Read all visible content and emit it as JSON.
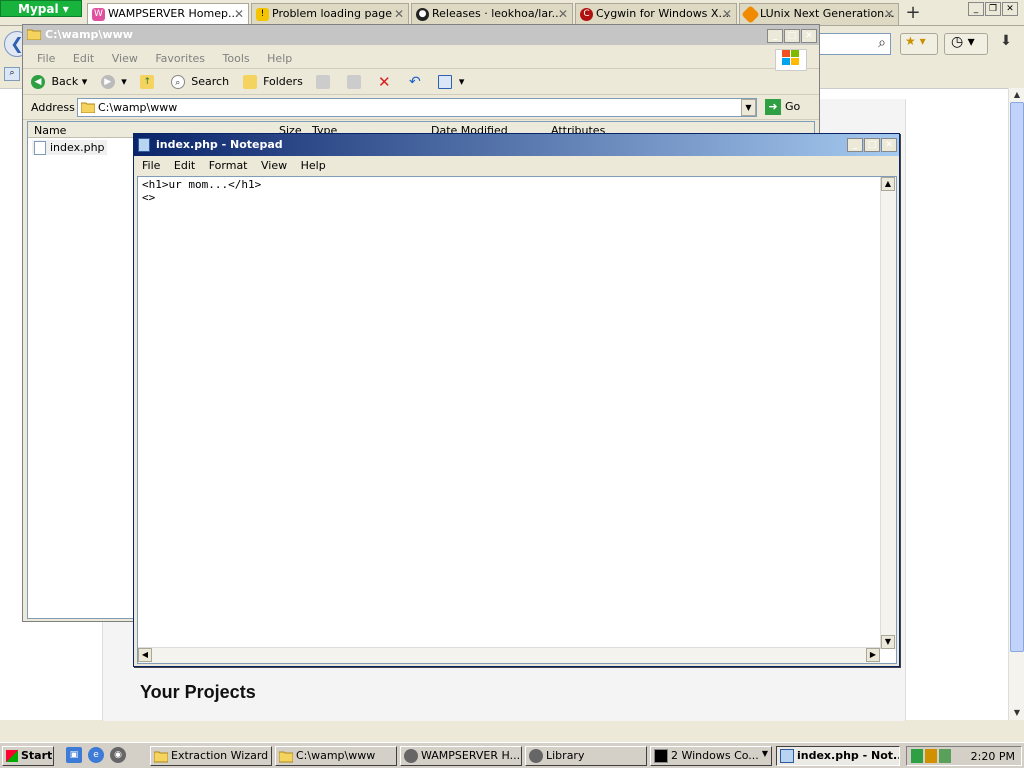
{
  "browser": {
    "app_button": "Mypal",
    "tabs": [
      {
        "label": "WAMPSERVER Homep...",
        "active": true
      },
      {
        "label": "Problem loading page",
        "active": false
      },
      {
        "label": "Releases · leokhoa/lar...",
        "active": false
      },
      {
        "label": "Cygwin for Windows X...",
        "active": false
      },
      {
        "label": "LUnix Next Generation...",
        "active": false
      }
    ],
    "new_tab": "+",
    "colors": {
      "mypal_green": "#18b33d"
    }
  },
  "web_page": {
    "heading": "Your Projects"
  },
  "explorer": {
    "title": "C:\\wamp\\www",
    "menu": [
      "File",
      "Edit",
      "View",
      "Favorites",
      "Tools",
      "Help"
    ],
    "toolbar": {
      "back": "Back",
      "search": "Search",
      "folders": "Folders"
    },
    "address_label": "Address",
    "address_value": "C:\\wamp\\www",
    "go_label": "Go",
    "columns": [
      "Name",
      "Size",
      "Type",
      "Date Modified",
      "Attributes"
    ],
    "files": [
      {
        "name": "index.php"
      }
    ]
  },
  "notepad": {
    "title": "index.php - Notepad",
    "menu": [
      "File",
      "Edit",
      "Format",
      "View",
      "Help"
    ],
    "content": "<h1>ur mom...</h1>\n<>"
  },
  "taskbar": {
    "start_label": "Start",
    "tasks": [
      {
        "label": "Extraction Wizard",
        "active": false
      },
      {
        "label": "C:\\wamp\\www",
        "active": false
      },
      {
        "label": "WAMPSERVER H...",
        "active": false
      },
      {
        "label": "Library",
        "active": false
      },
      {
        "label": "2 Windows Co...",
        "active": false
      },
      {
        "label": "index.php - Not...",
        "active": true
      }
    ],
    "clock": "2:20 PM"
  }
}
